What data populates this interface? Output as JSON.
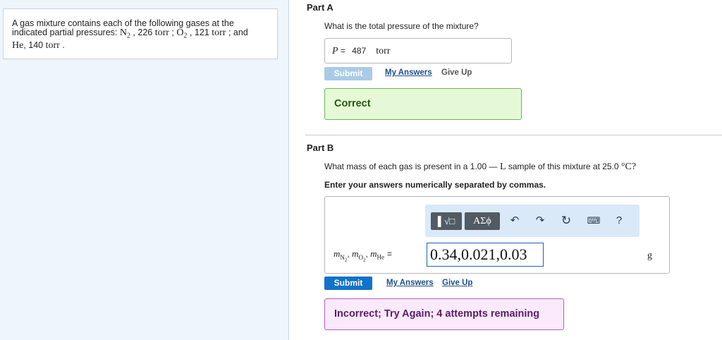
{
  "problem": {
    "line1": "A gas mixture contains each of the following gases at the",
    "line2_text": "indicated partial pressures: ",
    "n2": "N",
    "n2_sub": "2",
    "n2_val": " , 226 ",
    "torr": "torr",
    "sep": " ; ",
    "o2": "O",
    "o2_sub": "2",
    "o2_val": " , 121 ",
    "and": " ; and",
    "he": "He",
    "he_val": ", 140 ",
    "period": " ."
  },
  "partA": {
    "title": "Part A",
    "question": "What is the total pressure of the mixture?",
    "var": "P",
    "eq": " = ",
    "value": "487",
    "unit": "torr",
    "submit_label": "Submit",
    "my_answers_label": "My Answers",
    "give_up_label": "Give Up",
    "feedback": "Correct"
  },
  "partB": {
    "title": "Part B",
    "question_pre": "What mass of each gas is present in a 1.00 ",
    "question_dash": "—",
    "question_L": " L",
    "question_post": " sample of this mixture at 25.0 ",
    "question_deg": "°C?",
    "instruction": "Enter your answers numerically separated by commas.",
    "toolbar": {
      "templates_label": "▌√□",
      "symbols_label": "ΑΣϕ",
      "help_label": "?"
    },
    "labels": {
      "m": "m",
      "n2_sub": "N",
      "n2_subsub": "2",
      "o2_sub": "O",
      "o2_subsub": "2",
      "he_sub": "He",
      "comma": ", ",
      "eq": "="
    },
    "value": "0.34,0.021,0.03",
    "unit": "g",
    "submit_label": "Submit",
    "my_answers_label": "My Answers",
    "give_up_label": "Give Up",
    "feedback": "Incorrect; Try Again; 4 attempts remaining"
  }
}
